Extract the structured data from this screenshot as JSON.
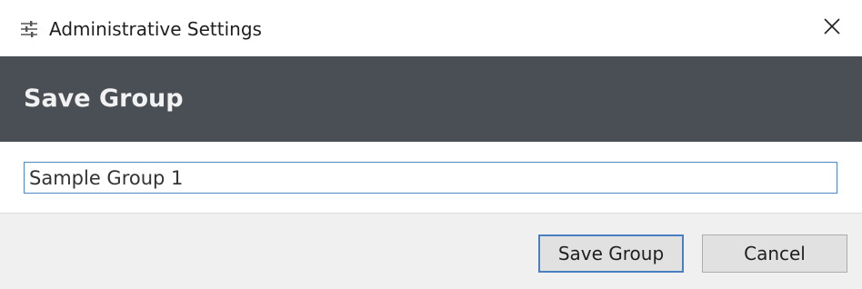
{
  "window": {
    "title": "Administrative Settings",
    "icon": "sliders-icon",
    "close_icon": "close-icon"
  },
  "header": {
    "heading": "Save Group"
  },
  "form": {
    "group_name_value": "Sample Group 1"
  },
  "footer": {
    "save_label": "Save Group",
    "cancel_label": "Cancel"
  },
  "colors": {
    "header_bg": "#4a4e55",
    "focus_border": "#4a7fc1",
    "footer_bg": "#f0f0f0"
  }
}
